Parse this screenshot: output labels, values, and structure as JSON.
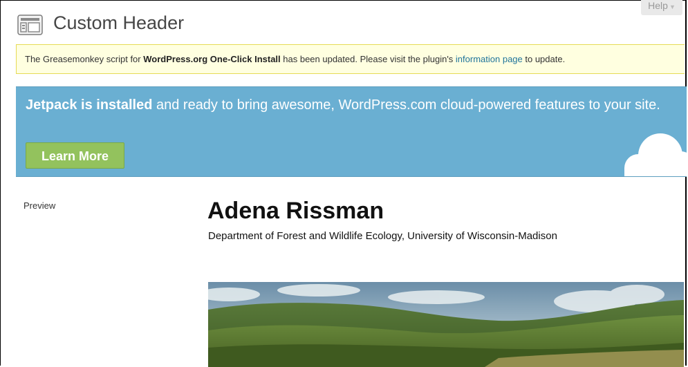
{
  "page": {
    "title": "Custom Header",
    "help_label": "Help",
    "help_caret": "▼"
  },
  "notice": {
    "text_before": "The Greasemonkey script for ",
    "plugin_name": "WordPress.org One-Click Install",
    "text_middle": " has been updated. Please visit the plugin's ",
    "link_text": "information page",
    "text_after": " to update."
  },
  "jetpack": {
    "headline_bold": "Jetpack is installed",
    "headline_rest": " and ready to bring awesome, WordPress.com cloud-powered features to your site.",
    "button_label": "Learn More"
  },
  "preview": {
    "label": "Preview",
    "site_title": "Adena Rissman",
    "site_description": "Department of Forest and Wildlife Ecology, University of Wisconsin-Madison"
  },
  "colors": {
    "jetpack_bg": "#6aafd2",
    "learn_more_bg": "#93c25d",
    "notice_bg": "#ffffe0",
    "link": "#21759b"
  }
}
